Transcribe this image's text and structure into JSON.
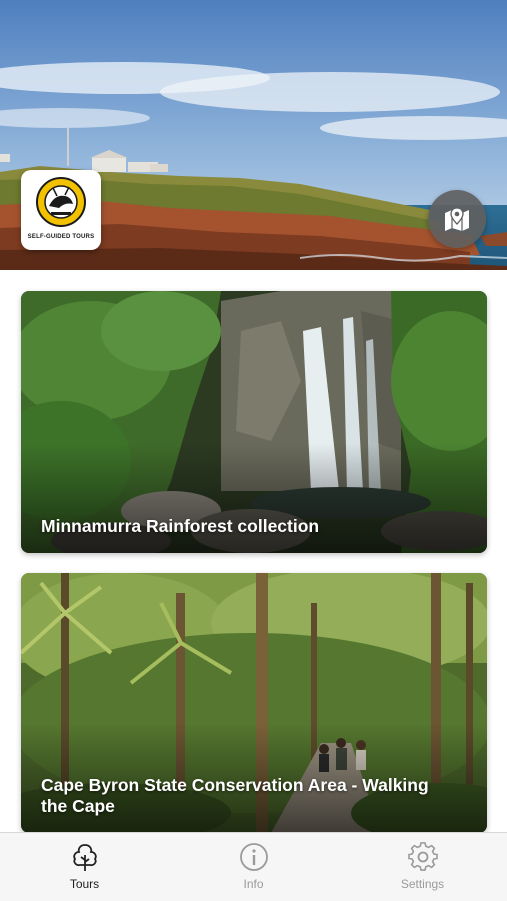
{
  "hero": {
    "logo_tagline": "SELF-GUIDED TOURS",
    "logo_emblem_text": "NATIONAL PARKS & WILDLIFE SERVICE NSW",
    "map_button_icon": "map-pin-icon"
  },
  "tours": [
    {
      "title": "Minnamurra Rainforest collection"
    },
    {
      "title": "Cape Byron State Conservation Area - Walking the Cape"
    }
  ],
  "tabbar": {
    "tabs": [
      {
        "label": "Tours",
        "icon": "tree-icon",
        "active": true
      },
      {
        "label": "Info",
        "icon": "info-icon",
        "active": false
      },
      {
        "label": "Settings",
        "icon": "gear-icon",
        "active": false
      }
    ]
  },
  "colors": {
    "tab_active": "#222222",
    "tab_inactive": "#9a9a9a",
    "map_button_bg": "#5f5f5f"
  }
}
